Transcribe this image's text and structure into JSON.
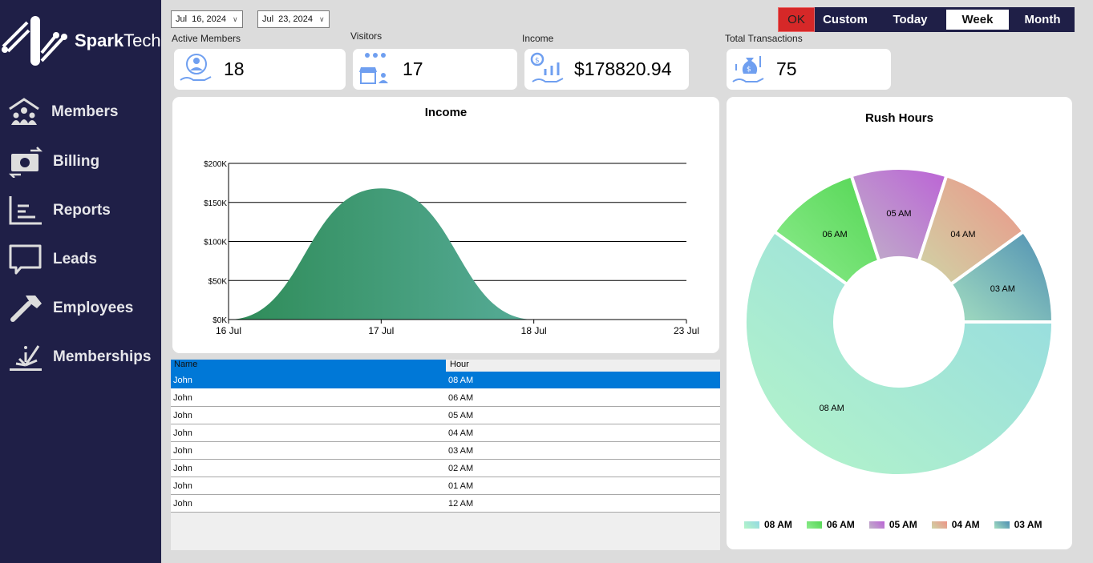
{
  "app": {
    "brand_bold": "Spark",
    "brand_light": "Tech"
  },
  "sidebar": {
    "items": [
      {
        "label": "Members",
        "icon": "members-house-icon"
      },
      {
        "label": "Billing",
        "icon": "billing-money-icon"
      },
      {
        "label": "Reports",
        "icon": "reports-chart-icon"
      },
      {
        "label": "Leads",
        "icon": "leads-chat-icon"
      },
      {
        "label": "Employees",
        "icon": "employees-hammer-icon"
      },
      {
        "label": "Memberships",
        "icon": "memberships-burst-icon"
      }
    ]
  },
  "filters": {
    "start_date": "Jul  16, 2024",
    "end_date": "Jul  23, 2024",
    "ok_label": "OK",
    "ranges": [
      "Custom",
      "Today",
      "Week",
      "Month"
    ],
    "selected_range": "Week"
  },
  "kpis": {
    "active_members": {
      "label": "Active Members",
      "value": "18"
    },
    "visitors": {
      "label": "Visitors",
      "value": "17"
    },
    "income": {
      "label": "Income",
      "value": "$178820.94"
    },
    "transactions": {
      "label": "Total Transactions",
      "value": "75"
    }
  },
  "table": {
    "headers": [
      "Name",
      "Hour"
    ],
    "rows": [
      [
        "John",
        "08 AM"
      ],
      [
        "John",
        "06 AM"
      ],
      [
        "John",
        "05 AM"
      ],
      [
        "John",
        "04 AM"
      ],
      [
        "John",
        "03 AM"
      ],
      [
        "John",
        "02 AM"
      ],
      [
        "John",
        "01 AM"
      ],
      [
        "John",
        "12 AM"
      ]
    ],
    "selected_row": 0
  },
  "chart_data": [
    {
      "type": "area",
      "title": "Income",
      "x": [
        "16 Jul",
        "17 Jul",
        "18 Jul",
        "23 Jul"
      ],
      "values": [
        0,
        168000,
        0,
        0
      ],
      "y_ticks": [
        "$0K",
        "$50K",
        "$100K",
        "$150K",
        "$200K"
      ],
      "ylim": [
        0,
        200000
      ],
      "grid": true,
      "colors": [
        "#2e8b57",
        "#6bbcb8"
      ]
    },
    {
      "type": "pie",
      "title": "Rush Hours",
      "labels": [
        "08 AM",
        "06 AM",
        "05 AM",
        "04 AM",
        "03 AM"
      ],
      "values": [
        6,
        1,
        1,
        1,
        1
      ],
      "colors": [
        [
          "#b5f5c8",
          "#93d9e3"
        ],
        [
          "#8eec8e",
          "#54d654"
        ],
        [
          "#c0b2c8",
          "#bb63d6"
        ],
        [
          "#cfd4a6",
          "#ec9488"
        ],
        [
          "#a3ddc0",
          "#4f8fb3"
        ]
      ],
      "legend": "bottom"
    }
  ]
}
